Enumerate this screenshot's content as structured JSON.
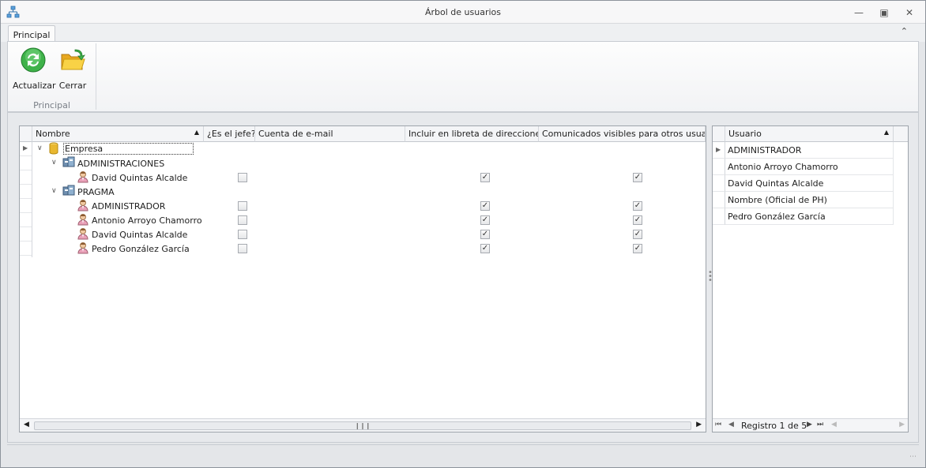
{
  "window": {
    "title": "Árbol de usuarios"
  },
  "tabs": [
    {
      "label": "Principal"
    }
  ],
  "ribbon": {
    "buttons": [
      {
        "label": "Actualizar",
        "icon": "refresh-icon"
      },
      {
        "label": "Cerrar",
        "icon": "folder-open-icon"
      }
    ],
    "group_label": "Principal"
  },
  "tree": {
    "columns": [
      "Nombre",
      "¿Es el jefe?",
      "Cuenta de e-mail",
      "Incluir en libreta de direcciones",
      "Comunicados visibles para otros usuarios"
    ],
    "rows": [
      {
        "label": "Empresa",
        "type": "root",
        "level": 0,
        "expanded": true
      },
      {
        "label": "ADMINISTRACIONES",
        "type": "group",
        "level": 1,
        "expanded": true
      },
      {
        "label": "David Quintas Alcalde",
        "type": "user",
        "level": 2,
        "jefe": false,
        "libreta": true,
        "comunicados": true
      },
      {
        "label": "PRAGMA",
        "type": "group",
        "level": 1,
        "expanded": true
      },
      {
        "label": "ADMINISTRADOR",
        "type": "user",
        "level": 2,
        "jefe": false,
        "libreta": true,
        "comunicados": true
      },
      {
        "label": "Antonio Arroyo Chamorro",
        "type": "user",
        "level": 2,
        "jefe": false,
        "libreta": true,
        "comunicados": true
      },
      {
        "label": "David Quintas Alcalde",
        "type": "user",
        "level": 2,
        "jefe": false,
        "libreta": true,
        "comunicados": true
      },
      {
        "label": "Pedro González García",
        "type": "user",
        "level": 2,
        "jefe": false,
        "libreta": true,
        "comunicados": true
      }
    ]
  },
  "users_grid": {
    "column": "Usuario",
    "rows": [
      "ADMINISTRADOR",
      "Antonio Arroyo Chamorro",
      "David Quintas Alcalde",
      "Nombre (Oficial de PH)",
      "Pedro González García"
    ],
    "navigator": "Registro 1 de 5"
  },
  "colors": {
    "accent": "#3d8fd6",
    "check": "#333333"
  }
}
